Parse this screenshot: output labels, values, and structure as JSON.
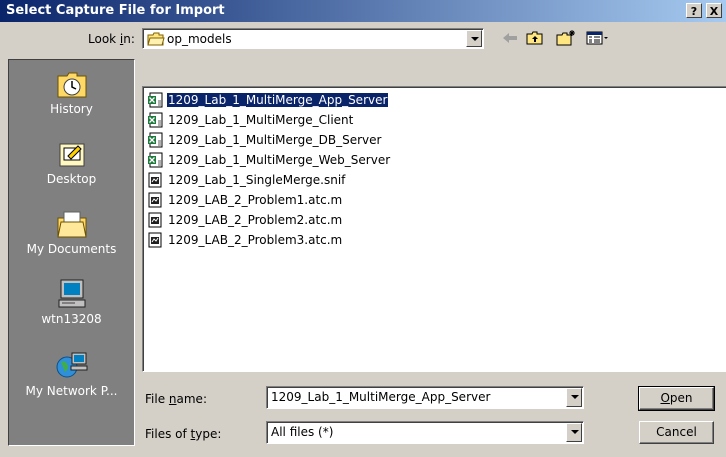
{
  "window": {
    "title": "Select Capture File for Import",
    "help_glyph": "?",
    "close_glyph": "X"
  },
  "lookin": {
    "label": "Look in:",
    "folder": "op_models"
  },
  "places": [
    {
      "label": "History",
      "icon": "history-icon"
    },
    {
      "label": "Desktop",
      "icon": "desktop-icon"
    },
    {
      "label": "My Documents",
      "icon": "my-documents-icon"
    },
    {
      "label": "wtn13208",
      "icon": "computer-icon"
    },
    {
      "label": "My Network P...",
      "icon": "network-places-icon"
    }
  ],
  "files": [
    {
      "name": "1209_Lab_1_MultiMerge_App_Server",
      "icon": "spreadsheet-file-icon",
      "selected": true
    },
    {
      "name": "1209_Lab_1_MultiMerge_Client",
      "icon": "spreadsheet-file-icon",
      "selected": false
    },
    {
      "name": "1209_Lab_1_MultiMerge_DB_Server",
      "icon": "spreadsheet-file-icon",
      "selected": false
    },
    {
      "name": "1209_Lab_1_MultiMerge_Web_Server",
      "icon": "spreadsheet-file-icon",
      "selected": false
    },
    {
      "name": "1209_Lab_1_SingleMerge.snif",
      "icon": "capture-file-icon",
      "selected": false
    },
    {
      "name": "1209_LAB_2_Problem1.atc.m",
      "icon": "capture-file-icon",
      "selected": false
    },
    {
      "name": "1209_LAB_2_Problem2.atc.m",
      "icon": "capture-file-icon",
      "selected": false
    },
    {
      "name": "1209_LAB_2_Problem3.atc.m",
      "icon": "capture-file-icon",
      "selected": false
    }
  ],
  "filename": {
    "label": "File name:",
    "value": "1209_Lab_1_MultiMerge_App_Server"
  },
  "filetype": {
    "label": "Files of type:",
    "value": "All files (*)"
  },
  "buttons": {
    "open": "Open",
    "cancel": "Cancel"
  },
  "colors": {
    "titlebar_start": "#0a246a",
    "titlebar_end": "#a6caf0",
    "selection": "#0a246a",
    "face": "#d4d0c8",
    "places_bg": "#808080"
  }
}
